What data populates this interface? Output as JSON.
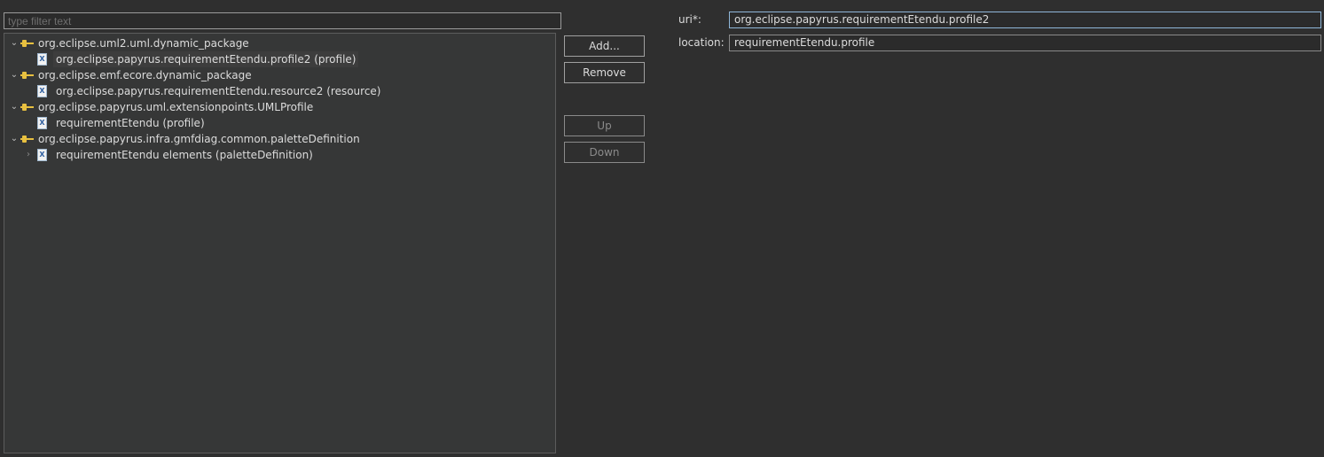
{
  "filter": {
    "placeholder": "type filter text",
    "value": ""
  },
  "tree": {
    "nodes": [
      {
        "label": "org.eclipse.uml2.uml.dynamic_package",
        "icon": "plugin-extension-icon"
      },
      {
        "label": "org.eclipse.papyrus.requirementEtendu.profile2 (profile)",
        "icon": "xml-file-icon",
        "selected": true
      },
      {
        "label": "org.eclipse.emf.ecore.dynamic_package",
        "icon": "plugin-extension-icon"
      },
      {
        "label": "org.eclipse.papyrus.requirementEtendu.resource2 (resource)",
        "icon": "xml-file-icon"
      },
      {
        "label": "org.eclipse.papyrus.uml.extensionpoints.UMLProfile",
        "icon": "plugin-extension-icon"
      },
      {
        "label": "requirementEtendu (profile)",
        "icon": "xml-file-icon"
      },
      {
        "label": "org.eclipse.papyrus.infra.gmfdiag.common.paletteDefinition",
        "icon": "plugin-extension-icon"
      },
      {
        "label": "requirementEtendu elements (paletteDefinition)",
        "icon": "xml-file-icon"
      }
    ]
  },
  "buttons": {
    "add": "Add...",
    "remove": "Remove",
    "up": "Up",
    "down": "Down"
  },
  "details": {
    "uri_label": "uri*:",
    "uri_value": "org.eclipse.papyrus.requirementEtendu.profile2",
    "location_label": "location:",
    "location_value": "requirementEtendu.profile"
  },
  "colors": {
    "background": "#2f2f2f",
    "tree_background": "#363737",
    "focus_border": "#8fb6d8",
    "plugin_icon": "#e8c040"
  }
}
